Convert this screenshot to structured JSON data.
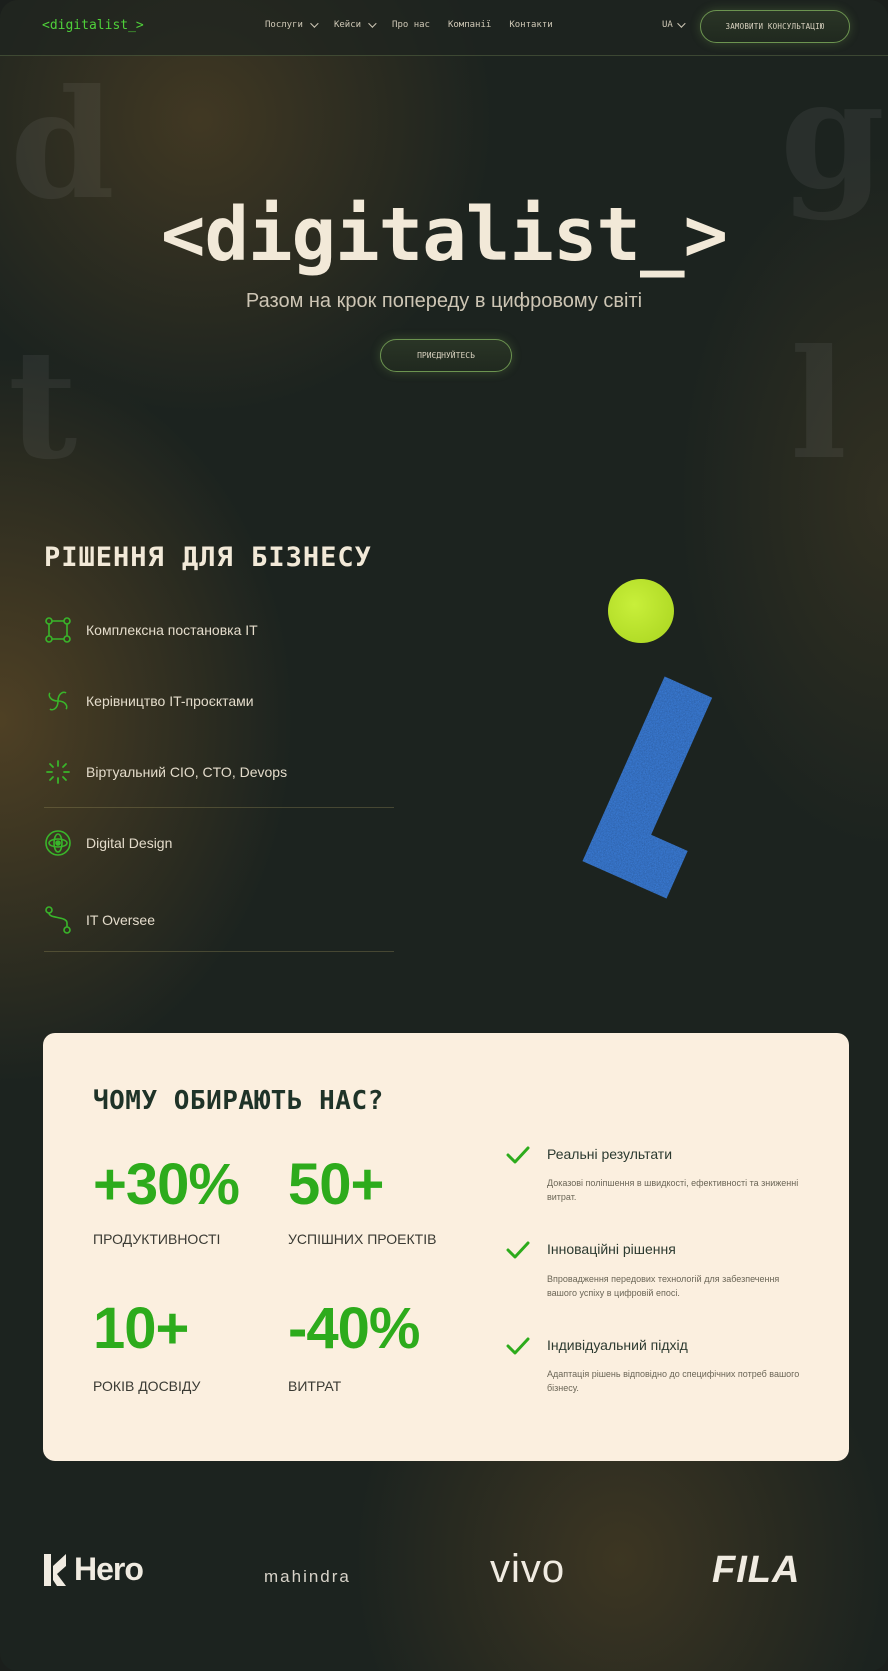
{
  "header": {
    "logo": "<digitalist_>",
    "nav": [
      {
        "label": "Послуги",
        "has_dropdown": true
      },
      {
        "label": "Кейси",
        "has_dropdown": true
      },
      {
        "label": "Про нас",
        "has_dropdown": false
      },
      {
        "label": "Компанії",
        "has_dropdown": false
      },
      {
        "label": "Контакти",
        "has_dropdown": false
      }
    ],
    "lang": "UA",
    "cta_label": "ЗАМОВИТИ КОНСУЛЬТАЦІЮ"
  },
  "hero": {
    "bg_letters": [
      "d",
      "g",
      "t",
      "l"
    ],
    "title": "<digitalist_>",
    "subtitle": "Разом на крок попереду в цифровому світі",
    "button_label": "ПРИЄДНУЙТЕСЬ"
  },
  "solutions": {
    "title": "РІШЕННЯ ДЛЯ БІЗНЕСУ",
    "items": [
      {
        "label": "Комплексна постановка IT",
        "icon": "network-nodes-icon"
      },
      {
        "label": "Керівництво IT-проєктами",
        "icon": "pinwheel-icon"
      },
      {
        "label": "Віртуальний CIO, CTO, Devops",
        "icon": "loader-icon"
      },
      {
        "label": "Digital Design",
        "icon": "atom-icon"
      },
      {
        "label": "IT Oversee",
        "icon": "route-icon"
      }
    ]
  },
  "why": {
    "title": "ЧОМУ ОБИРАЮТЬ НАС?",
    "stats": [
      {
        "value": "+30%",
        "label": "ПРОДУКТИВНОСТІ"
      },
      {
        "value": "50+",
        "label": "УСПІШНИХ ПРОЕКТІВ"
      },
      {
        "value": "10+",
        "label": "РОКІВ ДОСВІДУ"
      },
      {
        "value": "-40%",
        "label": "ВИТРАТ"
      }
    ],
    "features": [
      {
        "title": "Реальні результати",
        "desc": "Доказові поліпшення в швидкості, ефективності та зниженні витрат."
      },
      {
        "title": "Інноваційні рішення",
        "desc": "Впровадження передових технологій для забезпечення вашого успіху в цифровій епосі."
      },
      {
        "title": "Індивідуальний підхід",
        "desc": "Адаптація рішень відповідно до специфічних потреб вашого бізнесу."
      }
    ]
  },
  "logos": {
    "hero": "Hero",
    "mahindra": "mahindra",
    "vivo": "vivo",
    "fila": "FILA"
  },
  "colors": {
    "accent_green": "#2dab1c",
    "lime": "#b8e22a",
    "blue": "#3f86e8",
    "card_bg": "#fbefdf",
    "page_bg": "#1c231f"
  }
}
